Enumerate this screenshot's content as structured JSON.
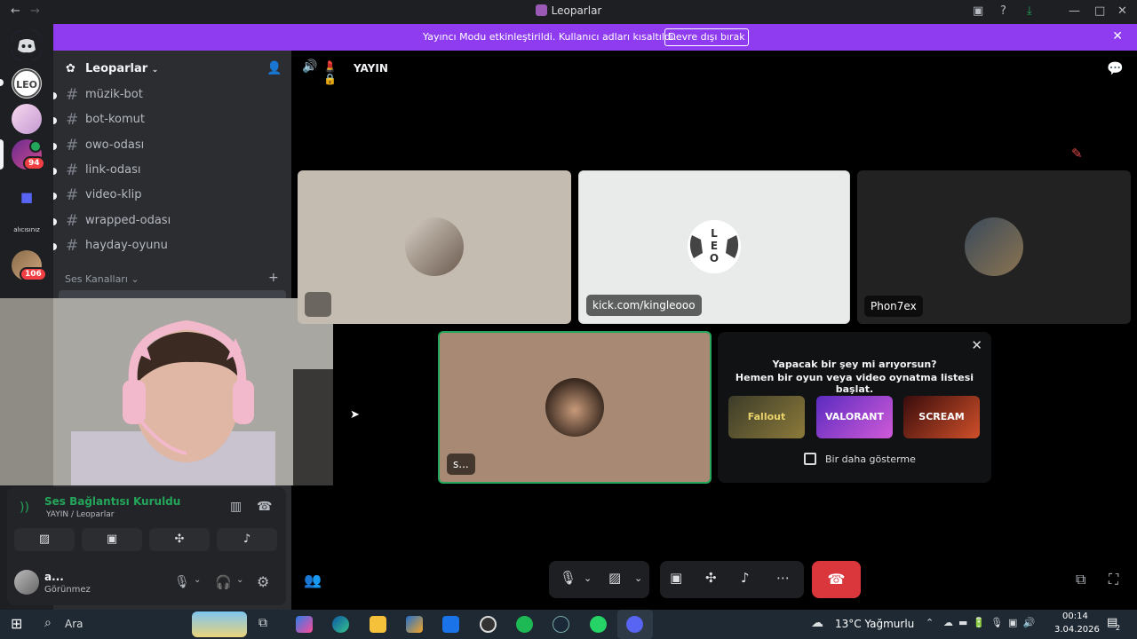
{
  "window": {
    "title": "Leoparlar"
  },
  "banner": {
    "text": "Yayıncı Modu etkinleştirildi. Kullanıcı adları kısaltıldı.",
    "button_label": "Devre dışı bırak"
  },
  "guilds": {
    "badge_1": "94",
    "badge_2": "106",
    "text_guild": "alıcısınız"
  },
  "sidebar": {
    "server_name": "Leoparlar",
    "channels": [
      {
        "name": "müzik-bot"
      },
      {
        "name": "bot-komut"
      },
      {
        "name": "owo-odası"
      },
      {
        "name": "link-odası"
      },
      {
        "name": "video-klip"
      },
      {
        "name": "wrapped-odası"
      },
      {
        "name": "hayday-oyunu"
      }
    ],
    "voice_category": "Ses Kanalları",
    "voice_channel": "YAYIN"
  },
  "voice_panel": {
    "status": "Ses Bağlantısı Kuruldu",
    "location": "YAYIN / Leoparlar"
  },
  "user_panel": {
    "name": "a...",
    "status": "Görünmez"
  },
  "main": {
    "channel_name": "YAYIN",
    "tiles": [
      {
        "label": ""
      },
      {
        "label": "kick.com/kingleooo"
      },
      {
        "label": "Phon7ex"
      },
      {
        "label": "s..."
      }
    ],
    "activity": {
      "title": "Yapacak bir şey mi arıyorsun?",
      "subtitle": "Hemen bir oyun veya video oynatma listesi başlat.",
      "games": [
        "Fallout",
        "VALORANT",
        "SCREAM"
      ],
      "checkbox_label": "Bir daha gösterme"
    }
  },
  "taskbar": {
    "search_label": "Ara",
    "weather": "13°C  Yağmurlu",
    "time": "00:14",
    "date": "3.04.2026",
    "notifications": "2"
  },
  "colors": {
    "banner": "#8f3cf0",
    "accent_green": "#23a55a",
    "hangup": "#da373c"
  }
}
